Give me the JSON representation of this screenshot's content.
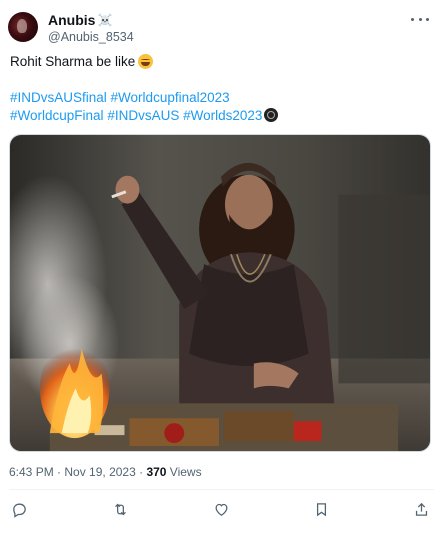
{
  "author": {
    "display_name": "Anubis",
    "handle": "@Anubis_8534",
    "name_emoji": "☠️"
  },
  "tweet": {
    "text": "Rohit Sharma be like",
    "text_emoji": "laugh-emoji",
    "hashtags_line1": [
      "#INDvsAUSfinal",
      "#Worldcupfinal2023"
    ],
    "hashtags_line2": [
      "#WorldcupFinal",
      "#INDvsAUS",
      "#Worlds2023"
    ]
  },
  "meta": {
    "time": "6:43 PM",
    "separator": " · ",
    "date": "Nov 19, 2023",
    "views_count": "370",
    "views_label": " Views"
  },
  "actions": [
    "reply-icon",
    "retweet-icon",
    "like-icon",
    "bookmark-icon",
    "share-icon"
  ],
  "colors": {
    "link": "#1d9bf0",
    "text": "#0f1419",
    "muted": "#536471",
    "divider": "#eff3f4"
  }
}
